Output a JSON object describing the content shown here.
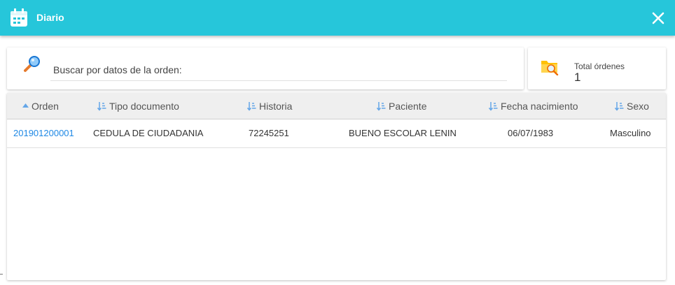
{
  "window": {
    "title": "Diario",
    "accent_color": "#26c6da",
    "title_icon": "calendar-icon",
    "close_icon": "close-icon"
  },
  "search": {
    "placeholder": "Buscar por datos de la orden:",
    "value": "",
    "icon": "search-icon"
  },
  "summary": {
    "label": "Total órdenes",
    "value": "1",
    "icon": "folder-search-icon"
  },
  "table": {
    "columns": [
      {
        "label": "Orden",
        "sort_icon": "sort-ascending-icon",
        "sorted": "asc"
      },
      {
        "label": "Tipo documento",
        "sort_icon": "sort-icon"
      },
      {
        "label": "Historia",
        "sort_icon": "sort-icon"
      },
      {
        "label": "Paciente",
        "sort_icon": "sort-icon"
      },
      {
        "label": "Fecha nacimiento",
        "sort_icon": "sort-icon"
      },
      {
        "label": "Sexo",
        "sort_icon": "sort-icon"
      }
    ],
    "rows": [
      [
        "201901200001",
        "CEDULA DE CIUDADANIA",
        "72245251",
        "BUENO ESCOLAR LENIN",
        "06/07/1983",
        "Masculino"
      ]
    ]
  }
}
